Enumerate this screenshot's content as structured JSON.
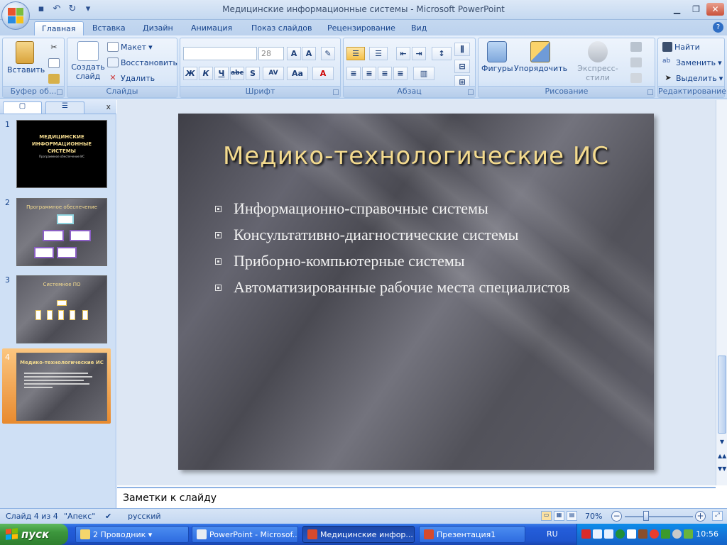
{
  "window": {
    "title": "Медицинские информационные системы - Microsoft PowerPoint"
  },
  "ribbon_tabs": [
    "Главная",
    "Вставка",
    "Дизайн",
    "Анимация",
    "Показ слайдов",
    "Рецензирование",
    "Вид"
  ],
  "ribbon": {
    "clipboard": {
      "label": "Буфер об...",
      "paste": "Вставить"
    },
    "slides": {
      "label": "Слайды",
      "new_slide_1": "Создать",
      "new_slide_2": "слайд",
      "layout": "Макет",
      "reset": "Восстановить",
      "delete": "Удалить"
    },
    "font": {
      "label": "Шрифт",
      "size": "28"
    },
    "paragraph": {
      "label": "Абзац"
    },
    "drawing": {
      "label": "Рисование",
      "shapes": "Фигуры",
      "arrange": "Упорядочить",
      "quick_styles": "Экспресс-стили"
    },
    "editing": {
      "label": "Редактирование",
      "find": "Найти",
      "replace": "Заменить",
      "select": "Выделить"
    }
  },
  "thumbnails": [
    {
      "num": "1",
      "title": "МЕДИЦИНСКИЕ ИНФОРМАЦИОННЫЕ СИСТЕМЫ",
      "subtitle": "Программное обеспечение ИС"
    },
    {
      "num": "2",
      "title": "Программное обеспечение"
    },
    {
      "num": "3",
      "title": "Системное ПО"
    },
    {
      "num": "4",
      "title": "Медико-технологические ИС"
    }
  ],
  "slide": {
    "title": "Медико-технологические ИС",
    "bullets": [
      "Информационно-справочные системы",
      "Консультативно-диагностические системы",
      "Приборно-компьютерные системы",
      "Автоматизированные рабочие места специалистов"
    ]
  },
  "notes": {
    "placeholder": "Заметки к слайду"
  },
  "status": {
    "slide": "Слайд 4 из 4",
    "theme": "\"Апекс\"",
    "language": "русский",
    "zoom": "70%"
  },
  "taskbar": {
    "start": "пуск",
    "tasks": [
      "2 Проводник",
      "PowerPoint - Microsof...",
      "Медицинские инфор...",
      "Презентация1"
    ],
    "lang": "RU",
    "clock": "10:56"
  },
  "colors": {
    "accent": "#15428b",
    "title_gold": "#f3da8e",
    "selection": "#f7a64a"
  }
}
